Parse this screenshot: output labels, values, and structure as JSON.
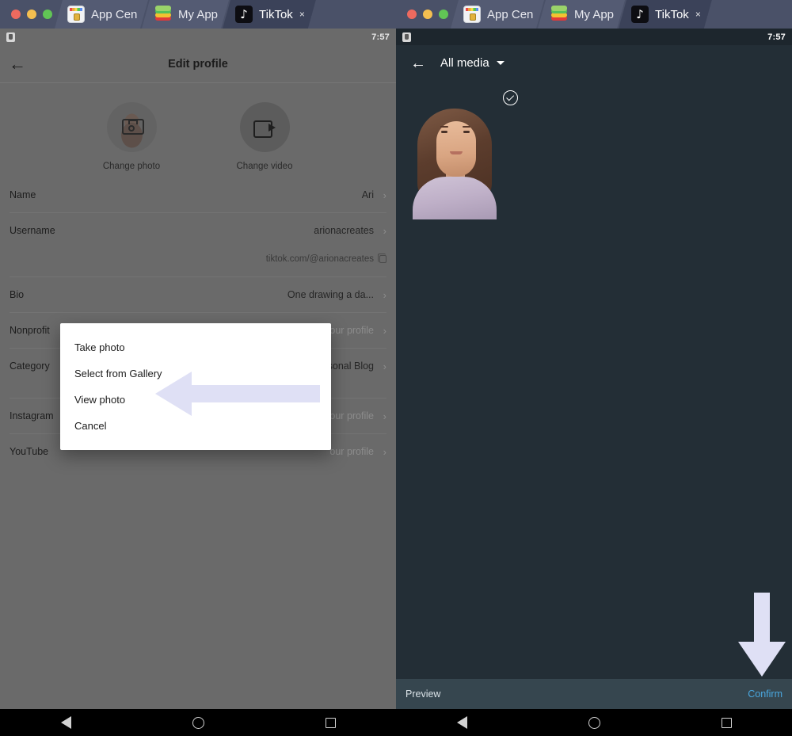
{
  "window": {
    "tabs": [
      {
        "label": "App Cen",
        "icon": "app-center-icon",
        "active": false,
        "close": ""
      },
      {
        "label": "My App",
        "icon": "bluestacks-layers-icon",
        "active": false,
        "close": ""
      },
      {
        "label": "TikTok",
        "icon": "tiktok-icon",
        "active": true,
        "close": "×"
      }
    ],
    "controls": [
      "close",
      "minimize",
      "maximize"
    ]
  },
  "left_panel": {
    "status": {
      "time": "7:57",
      "icon": "notification-icon"
    },
    "header": {
      "back": "←",
      "title": "Edit profile"
    },
    "media": [
      {
        "label": "Change photo",
        "icon": "camera-icon"
      },
      {
        "label": "Change video",
        "icon": "video-camera-icon"
      }
    ],
    "fields": [
      {
        "label": "Name",
        "value": "Ari",
        "muted": false,
        "chevron": "›"
      },
      {
        "label": "Username",
        "value": "arionacreates",
        "muted": false,
        "chevron": "›"
      },
      {
        "label": "",
        "value": "tiktok.com/@arionacreates",
        "muted": false,
        "chevron": "copy"
      },
      {
        "label": "Bio",
        "value": "One drawing a da...",
        "muted": false,
        "chevron": "›"
      },
      {
        "label": "Nonprofit",
        "value": "Add nonprofit to your profile",
        "muted": true,
        "chevron": "›"
      },
      {
        "label": "Category",
        "value": "sonal Blog",
        "muted": false,
        "chevron": "›"
      },
      {
        "label": "Instagram",
        "value": "our profile",
        "muted": true,
        "chevron": "›"
      },
      {
        "label": "YouTube",
        "value": "our profile",
        "muted": true,
        "chevron": "›"
      }
    ],
    "dialog": {
      "items": [
        "Take photo",
        "Select from Gallery",
        "View photo",
        "Cancel"
      ],
      "highlight_target": "Select from Gallery",
      "annotation_color": "#dfe0f5"
    }
  },
  "right_panel": {
    "status": {
      "time": "7:57",
      "icon": "notification-icon"
    },
    "header": {
      "back": "←",
      "title": "All media",
      "caret": "▾"
    },
    "gallery": {
      "items": [
        {
          "name": "portrait-photo",
          "selected": true,
          "check": "✓"
        }
      ]
    },
    "bottom_bar": {
      "preview": "Preview",
      "confirm": "Confirm",
      "confirm_color": "#4aa8e0"
    },
    "annotation_color": "#dfe0f5"
  },
  "nav": {
    "back": "back-triangle",
    "home": "home-circle",
    "recents": "recents-square"
  }
}
